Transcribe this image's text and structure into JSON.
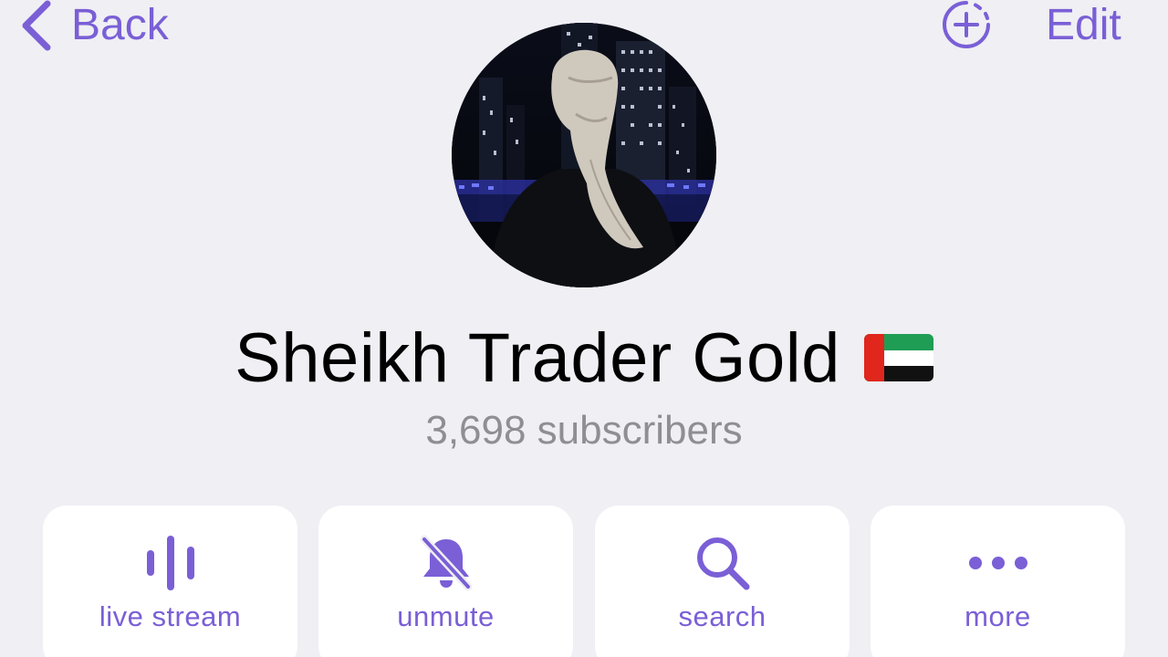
{
  "nav": {
    "back_label": "Back",
    "edit_label": "Edit"
  },
  "profile": {
    "title": "Sheikh Trader Gold",
    "subscribers": "3,698 subscribers"
  },
  "actions": [
    {
      "label": "live stream",
      "icon": "live-stream-icon"
    },
    {
      "label": "unmute",
      "icon": "bell-muted-icon"
    },
    {
      "label": "search",
      "icon": "search-icon"
    },
    {
      "label": "more",
      "icon": "ellipsis-icon"
    }
  ],
  "colors": {
    "accent": "#7a5fd6",
    "background": "#efeff4",
    "secondary_text": "#8e8e93",
    "card": "#ffffff"
  }
}
